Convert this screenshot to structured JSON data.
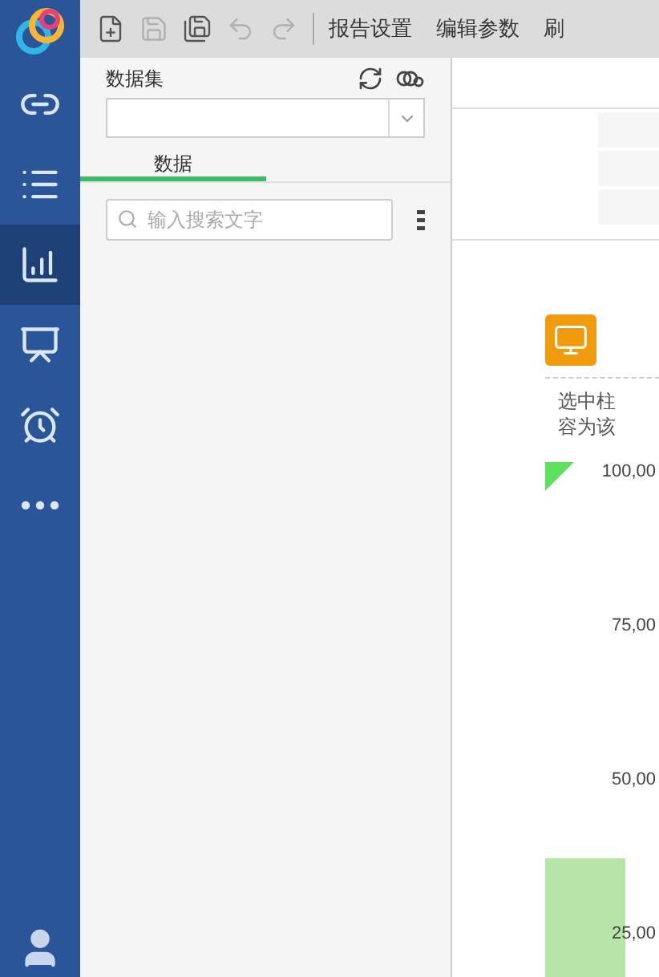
{
  "sidebar": {
    "items": [
      {
        "kind": "link",
        "selected": false
      },
      {
        "kind": "list",
        "selected": false
      },
      {
        "kind": "chart",
        "selected": true
      },
      {
        "kind": "presentation",
        "selected": false
      },
      {
        "kind": "alarm",
        "selected": false
      },
      {
        "kind": "more",
        "selected": false
      }
    ]
  },
  "toolbar": {
    "icons": [
      {
        "kind": "new",
        "disabled": false
      },
      {
        "kind": "save",
        "disabled": true
      },
      {
        "kind": "saveas",
        "disabled": false
      },
      {
        "kind": "undo",
        "disabled": true
      },
      {
        "kind": "redo",
        "disabled": true
      }
    ],
    "buttons": [
      "报告设置",
      "编辑参数",
      "刷"
    ]
  },
  "dataset_panel": {
    "label": "数据集",
    "tabs": [
      {
        "label": "数据",
        "selected": true
      }
    ],
    "search": {
      "placeholder": "输入搜索文字"
    }
  },
  "canvas": {
    "note_lines": [
      "选中柱",
      "容为该"
    ],
    "axis_labels": [
      "100,00",
      "75,00",
      "50,00",
      "25,00"
    ]
  }
}
